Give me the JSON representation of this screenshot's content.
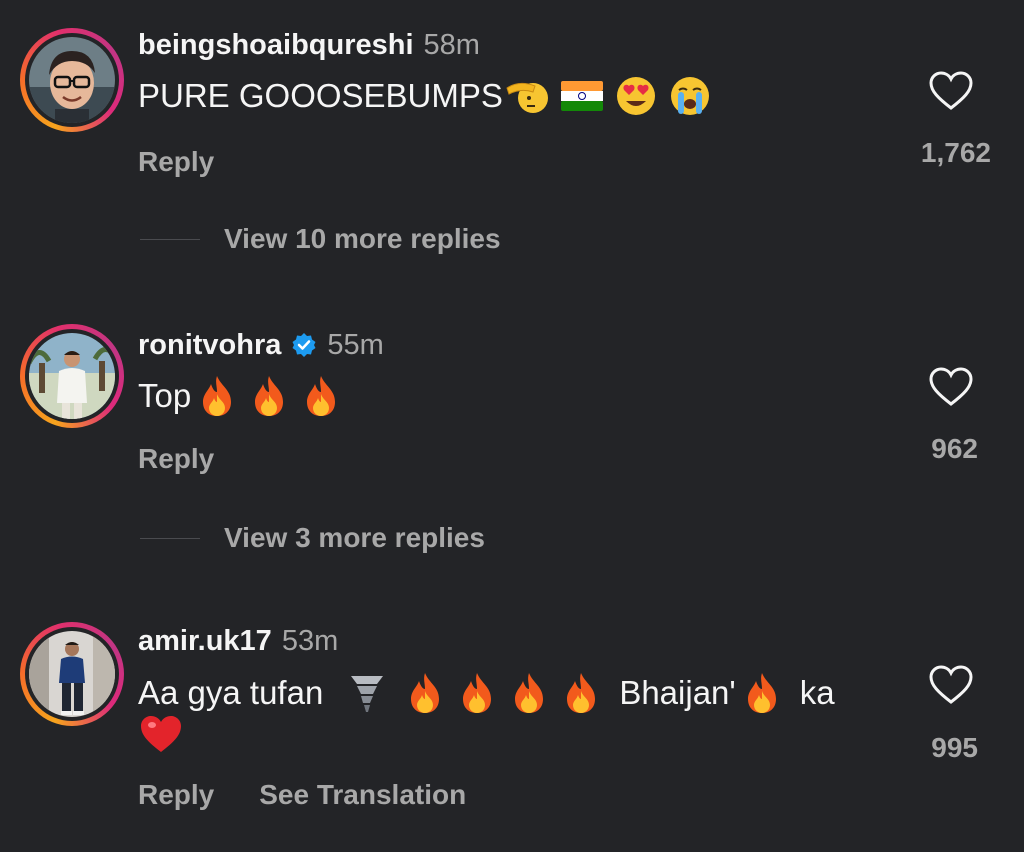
{
  "comments": [
    {
      "username": "beingshoaibqureshi",
      "time": "58m",
      "text": "PURE GOOOSEBUMPS",
      "emojis": [
        "saluting-face",
        "india-flag",
        "heart-eyes",
        "loudly-crying"
      ],
      "likes": "1,762",
      "reply_label": "Reply",
      "view_replies_label": "View 10 more replies"
    },
    {
      "username": "ronitvohra",
      "time": "55m",
      "verified": true,
      "text": "Top",
      "emojis": [
        "fire",
        "fire",
        "fire"
      ],
      "likes": "962",
      "reply_label": "Reply",
      "view_replies_label": "View 3 more replies"
    },
    {
      "username": "amir.uk17",
      "time": "53m",
      "text_part1": "Aa gya tufan",
      "text_part2": "Bhaijan'",
      "text_part3": "ka",
      "emojis": [
        "tornado",
        "fire",
        "fire",
        "fire",
        "fire",
        "fire",
        "red-heart"
      ],
      "likes": "995",
      "reply_label": "Reply",
      "translation_label": "See Translation"
    }
  ],
  "colors": {
    "background": "#232427",
    "primary_text": "#f5f5f5",
    "secondary_text": "#a8a8a8",
    "verified_blue": "#1d9bf0"
  }
}
